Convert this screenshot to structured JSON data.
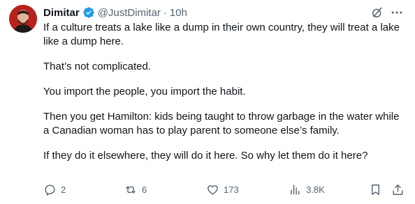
{
  "author": {
    "name": "Dimitar",
    "handle": "@JustDimitar",
    "separator": "·",
    "time": "10h",
    "verified": true
  },
  "icons": {
    "verified": "verified-badge-icon",
    "grok": "grok-icon",
    "more": "more-options-icon",
    "reply": "reply-icon",
    "retweet": "retweet-icon",
    "like": "like-icon",
    "views": "views-icon",
    "bookmark": "bookmark-icon",
    "share": "share-icon"
  },
  "colors": {
    "text": "#0f1419",
    "secondary": "#536471",
    "verified": "#1d9bf0"
  },
  "tweet": {
    "paragraphs": [
      "If a culture treats a lake like a dump in their own country, they will treat a lake like a dump here.",
      "That’s not complicated.",
      "You import the people, you import the habit.",
      "Then you get Hamilton: kids being taught to throw garbage in the water while a Canadian woman has to play parent to someone else’s family.",
      "If they do it elsewhere, they will do it here. So why let them do it here?"
    ]
  },
  "stats": {
    "replies": "2",
    "retweets": "6",
    "likes": "173",
    "views": "3.8K"
  }
}
